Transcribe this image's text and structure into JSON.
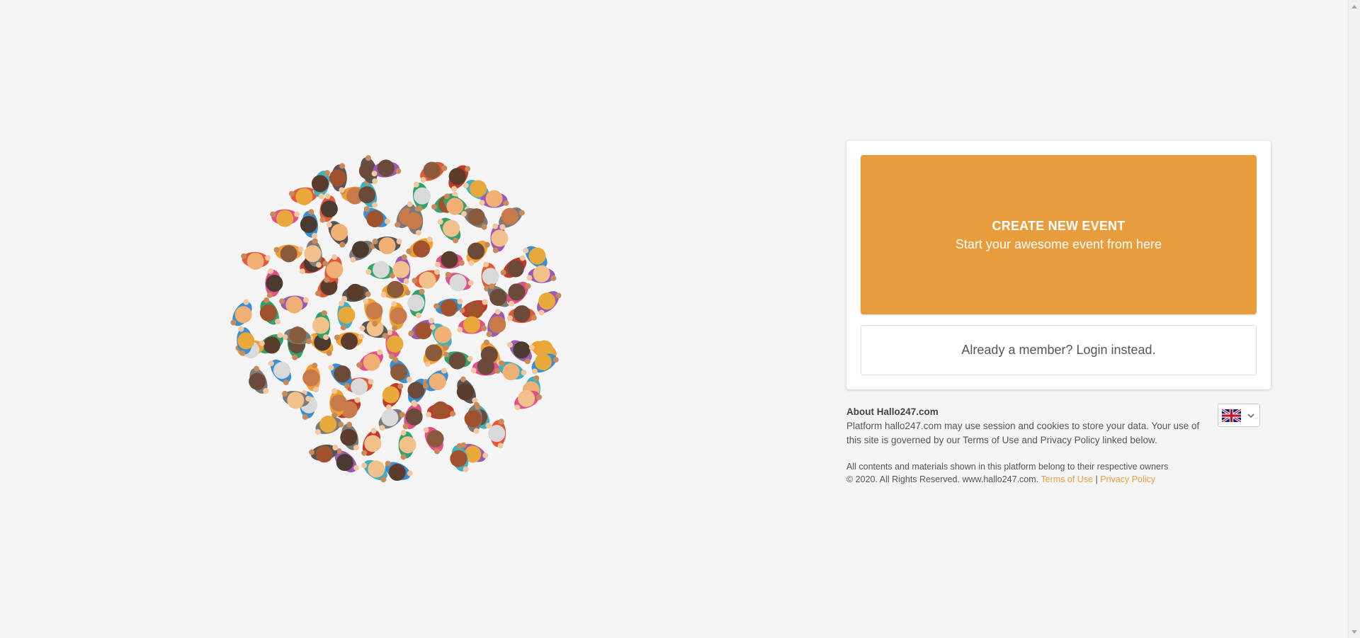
{
  "card": {
    "create_title": "CREATE NEW EVENT",
    "create_subtitle": "Start your awesome event from here",
    "login_label": "Already a member? Login instead."
  },
  "about": {
    "title": "About Hallo247.com",
    "text": "Platform hallo247.com may use session and cookies to store your data. Your use of this site is governed by our Terms of Use and Privacy Policy linked below."
  },
  "language": {
    "selected": "English (UK)",
    "icon": "uk-flag-icon"
  },
  "footer": {
    "line1": "All contents and materials shown in this platform belong to their respective owners",
    "copyright": "© 2020. All Rights Reserved. www.hallo247.com.",
    "terms_label": "Terms of Use",
    "separator": "|",
    "privacy_label": "Privacy Policy"
  },
  "colors": {
    "accent": "#e99c3c",
    "background": "#f4f4f4"
  }
}
